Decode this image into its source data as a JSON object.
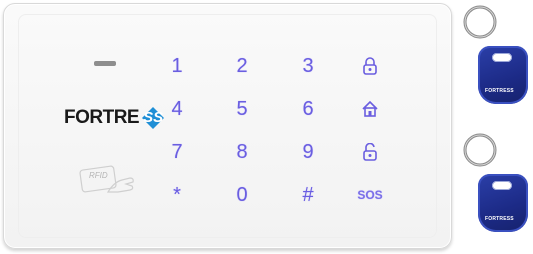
{
  "keypad": {
    "brand": {
      "text": "FORTRE",
      "badge": "SS"
    },
    "rfid_label": "RFID",
    "keys": [
      {
        "label": "1"
      },
      {
        "label": "2"
      },
      {
        "label": "3"
      },
      {
        "icon": "lock-closed-icon"
      },
      {
        "label": "4"
      },
      {
        "label": "5"
      },
      {
        "label": "6"
      },
      {
        "icon": "home-icon"
      },
      {
        "label": "7"
      },
      {
        "label": "8"
      },
      {
        "label": "9"
      },
      {
        "icon": "lock-open-icon"
      },
      {
        "label": "*"
      },
      {
        "label": "0"
      },
      {
        "label": "#"
      },
      {
        "label": "SOS"
      }
    ],
    "colors": {
      "key_backlight": "#6a5ee0",
      "fob_blue": "#1c2a86",
      "brand_badge": "#1f8fd6"
    }
  },
  "fobs": [
    {
      "label": "FORTRESS"
    },
    {
      "label": "FORTRESS"
    }
  ]
}
